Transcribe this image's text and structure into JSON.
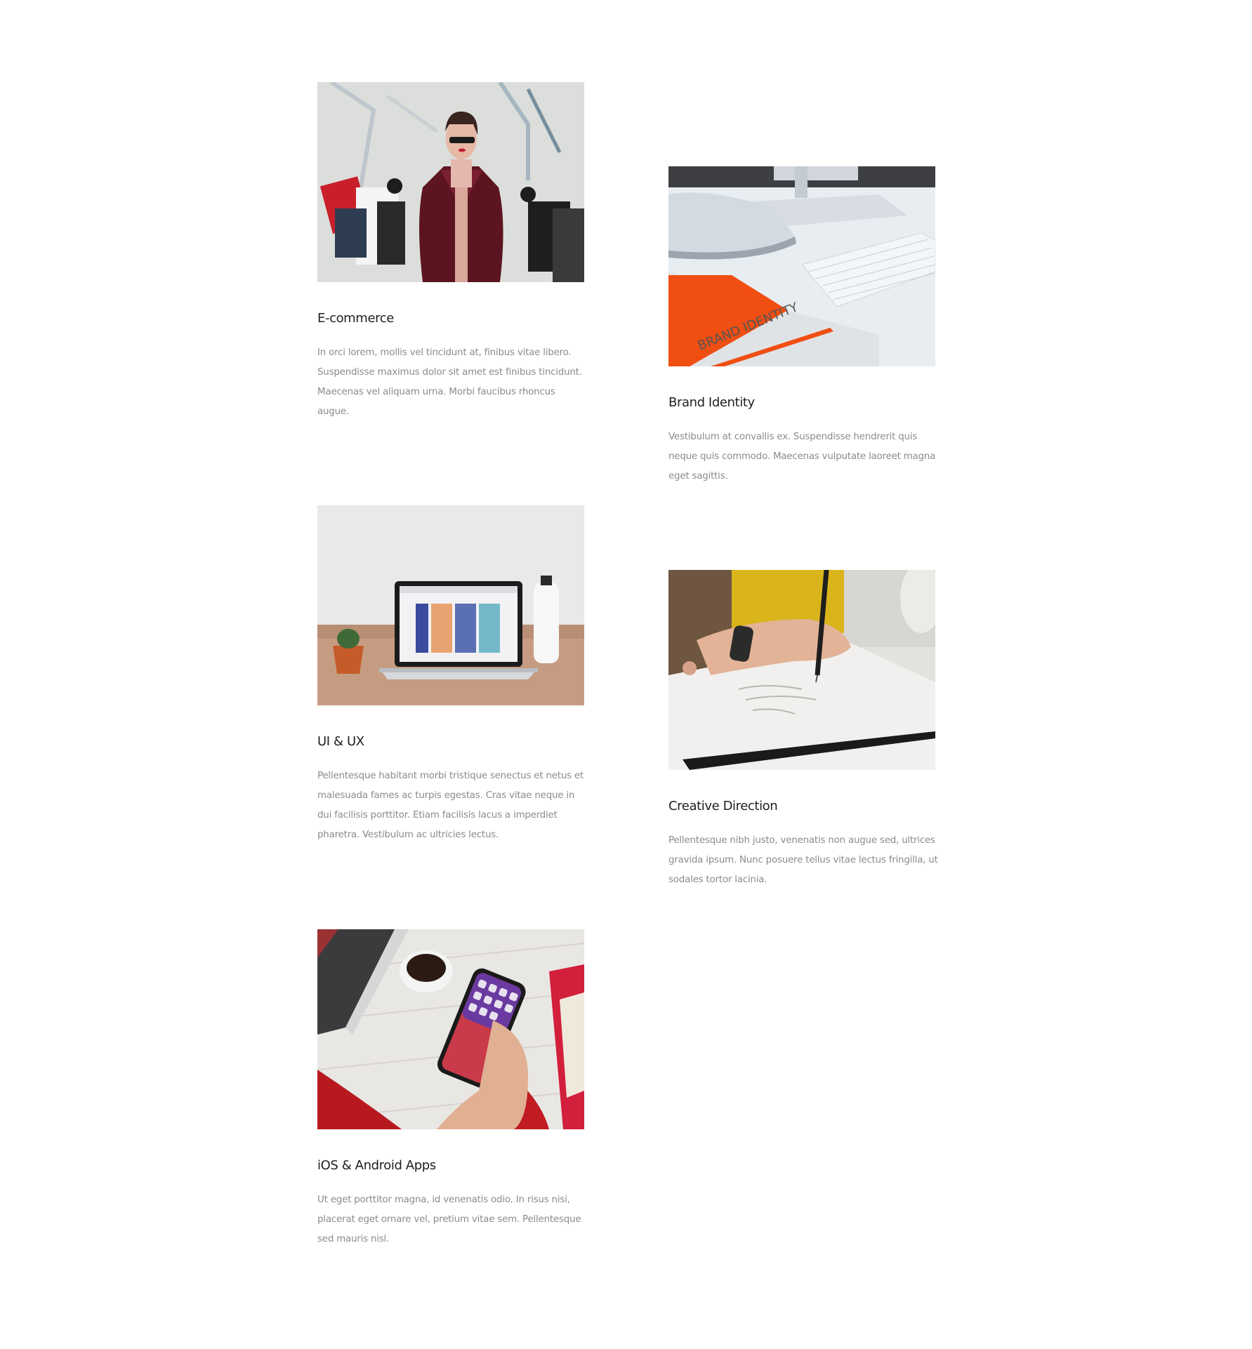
{
  "projects": [
    {
      "title": "E-commerce",
      "description": "In orci lorem, mollis vel tincidunt at, finibus vitae libero. Suspendisse maximus dolor sit amet est finibus tincidunt. Maecenas vel aliquam urna. Morbi faucibus rhoncus augue.",
      "image": "woman-with-shopping-bags-photo"
    },
    {
      "title": "Brand Identity",
      "description": "Vestibulum at convallis ex. Suspendisse hendrerit quis neque quis commodo. Maecenas vulputate laoreet magna eget sagittis.",
      "image": "desk-keyboard-brand-book-photo",
      "image_text": "BRAND IDENTITY"
    },
    {
      "title": "UI & UX",
      "description": "Pellentesque habitant morbi tristique senectus et netus et malesuada fames ac turpis egestas. Cras vitae neque in dui facilisis porttitor. Etiam facilisis lacus a imperdiet pharetra. Vestibulum ac ultricies lectus.",
      "image": "laptop-on-desk-photo"
    },
    {
      "title": "Creative Direction",
      "description": "Pellentesque nibh justo, venenatis non augue sed, ultrices gravida ipsum. Nunc posuere tellus vitae lectus fringilla, ut sodales tortor lacinia.",
      "image": "hand-sketching-photo"
    },
    {
      "title": "iOS & Android Apps",
      "description": "Ut eget porttitor magna, id venenatis odio. In risus nisi, placerat eget ornare vel, pretium vitae sem. Pellentesque sed mauris nisl.",
      "image": "hand-holding-smartphone-photo"
    }
  ],
  "colors": {
    "background": "#ffffff",
    "heading": "#1f1f1f",
    "body_text": "#8b8b8b"
  }
}
